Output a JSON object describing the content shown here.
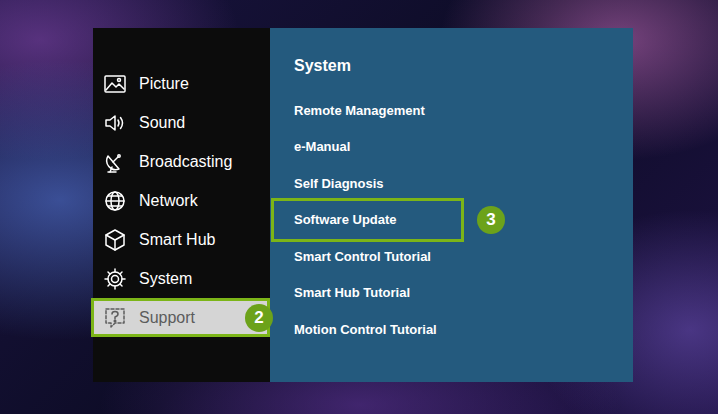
{
  "menu": {
    "items": [
      {
        "label": "Picture",
        "selected": false,
        "step": ""
      },
      {
        "label": "Sound",
        "selected": false,
        "step": ""
      },
      {
        "label": "Broadcasting",
        "selected": false,
        "step": ""
      },
      {
        "label": "Network",
        "selected": false,
        "step": ""
      },
      {
        "label": "Smart Hub",
        "selected": false,
        "step": ""
      },
      {
        "label": "System",
        "selected": false,
        "step": ""
      },
      {
        "label": "Support",
        "selected": true,
        "step": "2"
      }
    ]
  },
  "submenu": {
    "title": "System",
    "items": [
      {
        "label": "Remote Management",
        "highlighted": false,
        "step": ""
      },
      {
        "label": "e-Manual",
        "highlighted": false,
        "step": ""
      },
      {
        "label": "Self Diagnosis",
        "highlighted": false,
        "step": ""
      },
      {
        "label": "Software Update",
        "highlighted": true,
        "step": "3"
      },
      {
        "label": "Smart Control Tutorial",
        "highlighted": false,
        "step": ""
      },
      {
        "label": "Smart Hub Tutorial",
        "highlighted": false,
        "step": ""
      },
      {
        "label": "Motion Control Tutorial",
        "highlighted": false,
        "step": ""
      }
    ]
  }
}
